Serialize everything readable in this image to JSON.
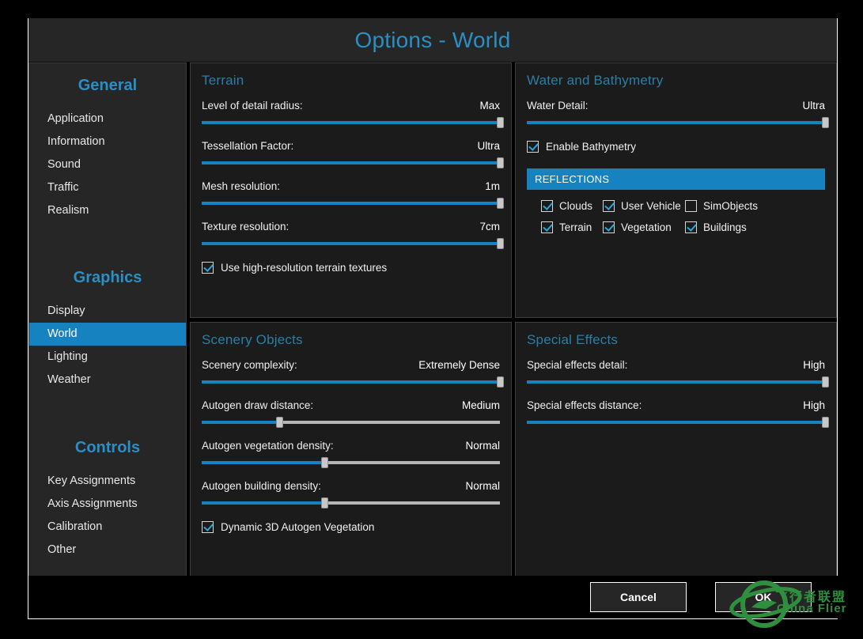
{
  "window": {
    "title": "Options - World"
  },
  "sidebar": {
    "groups": [
      {
        "heading": "General",
        "items": [
          {
            "label": "Application",
            "active": false
          },
          {
            "label": "Information",
            "active": false
          },
          {
            "label": "Sound",
            "active": false
          },
          {
            "label": "Traffic",
            "active": false
          },
          {
            "label": "Realism",
            "active": false
          }
        ]
      },
      {
        "heading": "Graphics",
        "items": [
          {
            "label": "Display",
            "active": false
          },
          {
            "label": "World",
            "active": true
          },
          {
            "label": "Lighting",
            "active": false
          },
          {
            "label": "Weather",
            "active": false
          }
        ]
      },
      {
        "heading": "Controls",
        "items": [
          {
            "label": "Key Assignments",
            "active": false
          },
          {
            "label": "Axis Assignments",
            "active": false
          },
          {
            "label": "Calibration",
            "active": false
          },
          {
            "label": "Other",
            "active": false
          }
        ]
      }
    ]
  },
  "panels": {
    "terrain": {
      "title": "Terrain",
      "sliders": [
        {
          "label": "Level of detail radius:",
          "value": "Max",
          "percent": 100
        },
        {
          "label": "Tessellation Factor:",
          "value": "Ultra",
          "percent": 100
        },
        {
          "label": "Mesh resolution:",
          "value": "1m",
          "percent": 100
        },
        {
          "label": "Texture resolution:",
          "value": "7cm",
          "percent": 100
        }
      ],
      "checkbox": {
        "label": "Use high-resolution terrain textures",
        "checked": true
      }
    },
    "water": {
      "title": "Water and Bathymetry",
      "sliders": [
        {
          "label": "Water Detail:",
          "value": "Ultra",
          "percent": 100
        }
      ],
      "checkbox": {
        "label": "Enable Bathymetry",
        "checked": true
      },
      "reflections": {
        "heading": "REFLECTIONS",
        "items": [
          {
            "label": "Clouds",
            "checked": true
          },
          {
            "label": "User Vehicle",
            "checked": true
          },
          {
            "label": "SimObjects",
            "checked": false
          },
          {
            "label": "Terrain",
            "checked": true
          },
          {
            "label": "Vegetation",
            "checked": true
          },
          {
            "label": "Buildings",
            "checked": true
          }
        ]
      }
    },
    "scenery": {
      "title": "Scenery Objects",
      "sliders": [
        {
          "label": "Scenery complexity:",
          "value": "Extremely Dense",
          "percent": 100
        },
        {
          "label": "Autogen draw distance:",
          "value": "Medium",
          "percent": 26
        },
        {
          "label": "Autogen vegetation density:",
          "value": "Normal",
          "percent": 41
        },
        {
          "label": "Autogen building density:",
          "value": "Normal",
          "percent": 41
        }
      ],
      "checkbox": {
        "label": "Dynamic 3D Autogen Vegetation",
        "checked": true
      }
    },
    "effects": {
      "title": "Special Effects",
      "sliders": [
        {
          "label": "Special effects detail:",
          "value": "High",
          "percent": 100
        },
        {
          "label": "Special effects distance:",
          "value": "High",
          "percent": 100
        }
      ]
    }
  },
  "footer": {
    "cancel_label": "Cancel",
    "ok_label": "OK"
  },
  "watermark": {
    "text_cn": "飞行者联盟",
    "text_en": "China Flier"
  },
  "colors": {
    "accent": "#1683c0",
    "title": "#2a8fc4",
    "panel_title": "#2b7ea6",
    "panel_bg": "#1b1b1b",
    "sidebar_bg": "#262626",
    "watermark_green": "#2f8f3e"
  }
}
